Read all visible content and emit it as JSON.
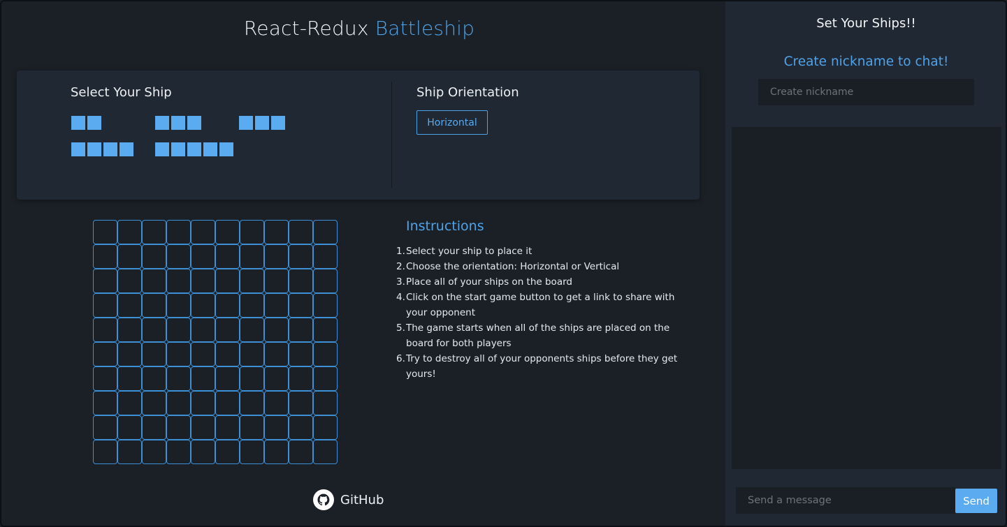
{
  "header": {
    "title_prefix": "React-Redux",
    "title_accent": "Battleship"
  },
  "ship_select": {
    "heading": "Select Your Ship",
    "ships": [
      {
        "name": "ship-2",
        "length": 2
      },
      {
        "name": "ship-3a",
        "length": 3
      },
      {
        "name": "ship-3b",
        "length": 3
      },
      {
        "name": "ship-4",
        "length": 4
      },
      {
        "name": "ship-5",
        "length": 5
      }
    ]
  },
  "orientation": {
    "heading": "Ship Orientation",
    "button_label": "Horizontal"
  },
  "board": {
    "rows": 10,
    "cols": 10
  },
  "instructions": {
    "title": "Instructions",
    "steps": [
      "Select your ship to place it",
      "Choose the orientation: Horizontal or Vertical",
      "Place all of your ships on the board",
      "Click on the start game button to get a link to share with your opponent",
      "The game starts when all of the ships are placed on the board for both players",
      "Try to destroy all of your opponents ships before they get yours!"
    ]
  },
  "footer": {
    "github_label": "GitHub",
    "github_icon": "github-icon"
  },
  "sidebar": {
    "title": "Set Your Ships!!",
    "chat_prompt": "Create nickname to chat!",
    "nickname_placeholder": "Create nickname",
    "message_placeholder": "Send a message",
    "send_label": "Send"
  },
  "colors": {
    "accent": "#4fa3e8",
    "ship": "#5aabf0",
    "background": "#1b2026",
    "panel": "#1f2833"
  }
}
